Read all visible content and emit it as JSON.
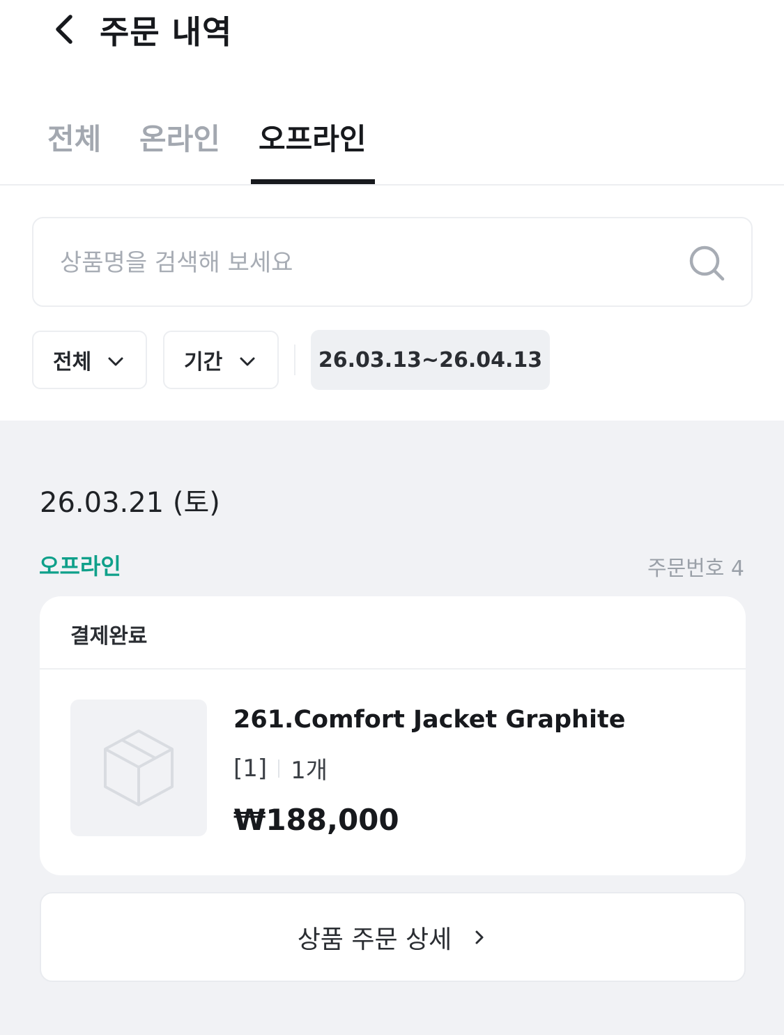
{
  "header": {
    "back_icon": "chevron-left-icon",
    "title": "주문 내역"
  },
  "tabs": [
    {
      "label": "전체",
      "active": false
    },
    {
      "label": "온라인",
      "active": false
    },
    {
      "label": "오프라인",
      "active": true
    }
  ],
  "search": {
    "placeholder": "상품명을 검색해 보세요",
    "value": "",
    "icon": "search-icon"
  },
  "filters": {
    "type_label": "전체",
    "period_label": "기간",
    "date_range": "26.03.13~26.04.13"
  },
  "order_group": {
    "date": "26.03.21 (토)",
    "channel": "오프라인",
    "order_number": "주문번호 4",
    "status": "결제완료",
    "product": {
      "name": "261.Comfort Jacket Graphite",
      "option": "[1]",
      "quantity": "1개",
      "price": "₩188,000",
      "image_icon": "package-icon"
    },
    "detail_button": "상품 주문 상세"
  },
  "colors": {
    "accent_green": "#0fa08a",
    "active_tab": "#17191d",
    "inactive_tab": "#a3a8b0",
    "section_bg": "#f1f2f5"
  }
}
